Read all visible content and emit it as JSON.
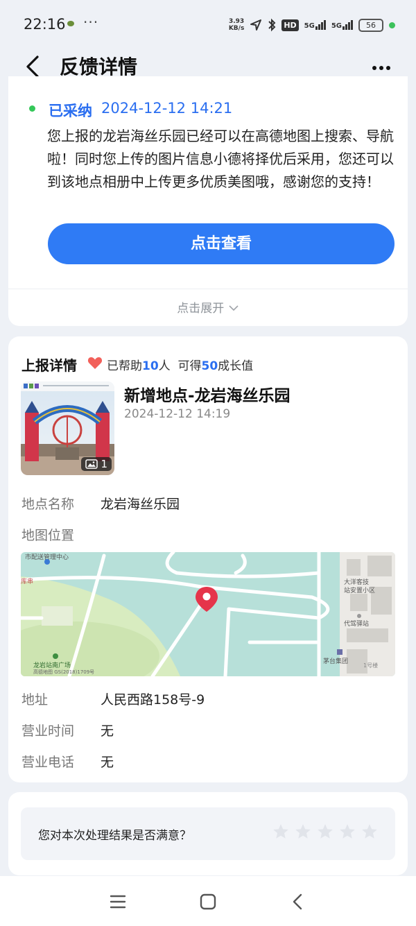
{
  "status_bar": {
    "time": "22:16",
    "more": "···",
    "net_speed_value": "3.93",
    "net_speed_unit": "KB/s",
    "hd": "HD",
    "signal1": "5G",
    "signal2": "5G",
    "battery": "56"
  },
  "header": {
    "title": "反馈详情"
  },
  "adoption": {
    "status": "已采纳",
    "time": "2024-12-12 14:21",
    "message": "您上报的龙岩海丝乐园已经可以在高德地图上搜索、导航啦！同时您上传的图片信息小德将择优后采用，您还可以到该地点相册中上传更多优质美图哦，感谢您的支持！",
    "button": "点击查看",
    "expand": "点击展开"
  },
  "report": {
    "section_title": "上报详情",
    "helped_prefix": "已帮助",
    "helped_count": "10",
    "helped_unit": "人",
    "growth_prefix": "可得",
    "growth_value": "50",
    "growth_suffix": "成长值",
    "photo_count": "1",
    "title": "新增地点-龙岩海丝乐园",
    "time": "2024-12-12 14:19",
    "fields": {
      "name_label": "地点名称",
      "name_value": "龙岩海丝乐园",
      "map_label": "地图位置",
      "address_label": "地址",
      "address_value": "人民西路158号-9",
      "hours_label": "营业时间",
      "hours_value": "无",
      "phone_label": "营业电话",
      "phone_value": "无"
    },
    "map_labels": {
      "top_left": "市配送管理中心",
      "left_edge": "库串",
      "poi_1": "大洋客技",
      "poi_2": "站安置小区",
      "poi_3": "代驾驿站",
      "poi_4": "茅台集团",
      "poi_5": "1号楼",
      "poi_6": "龙岩站南广场",
      "copyright": "高德地图 GS(2018)1709号"
    }
  },
  "feedback": {
    "question": "您对本次处理结果是否满意？",
    "rating": 0,
    "max_rating": 5
  },
  "colors": {
    "accent": "#2f7bf5",
    "text_blue": "#2a6ef0",
    "status_green": "#34c759",
    "heart": "#f2605a"
  }
}
